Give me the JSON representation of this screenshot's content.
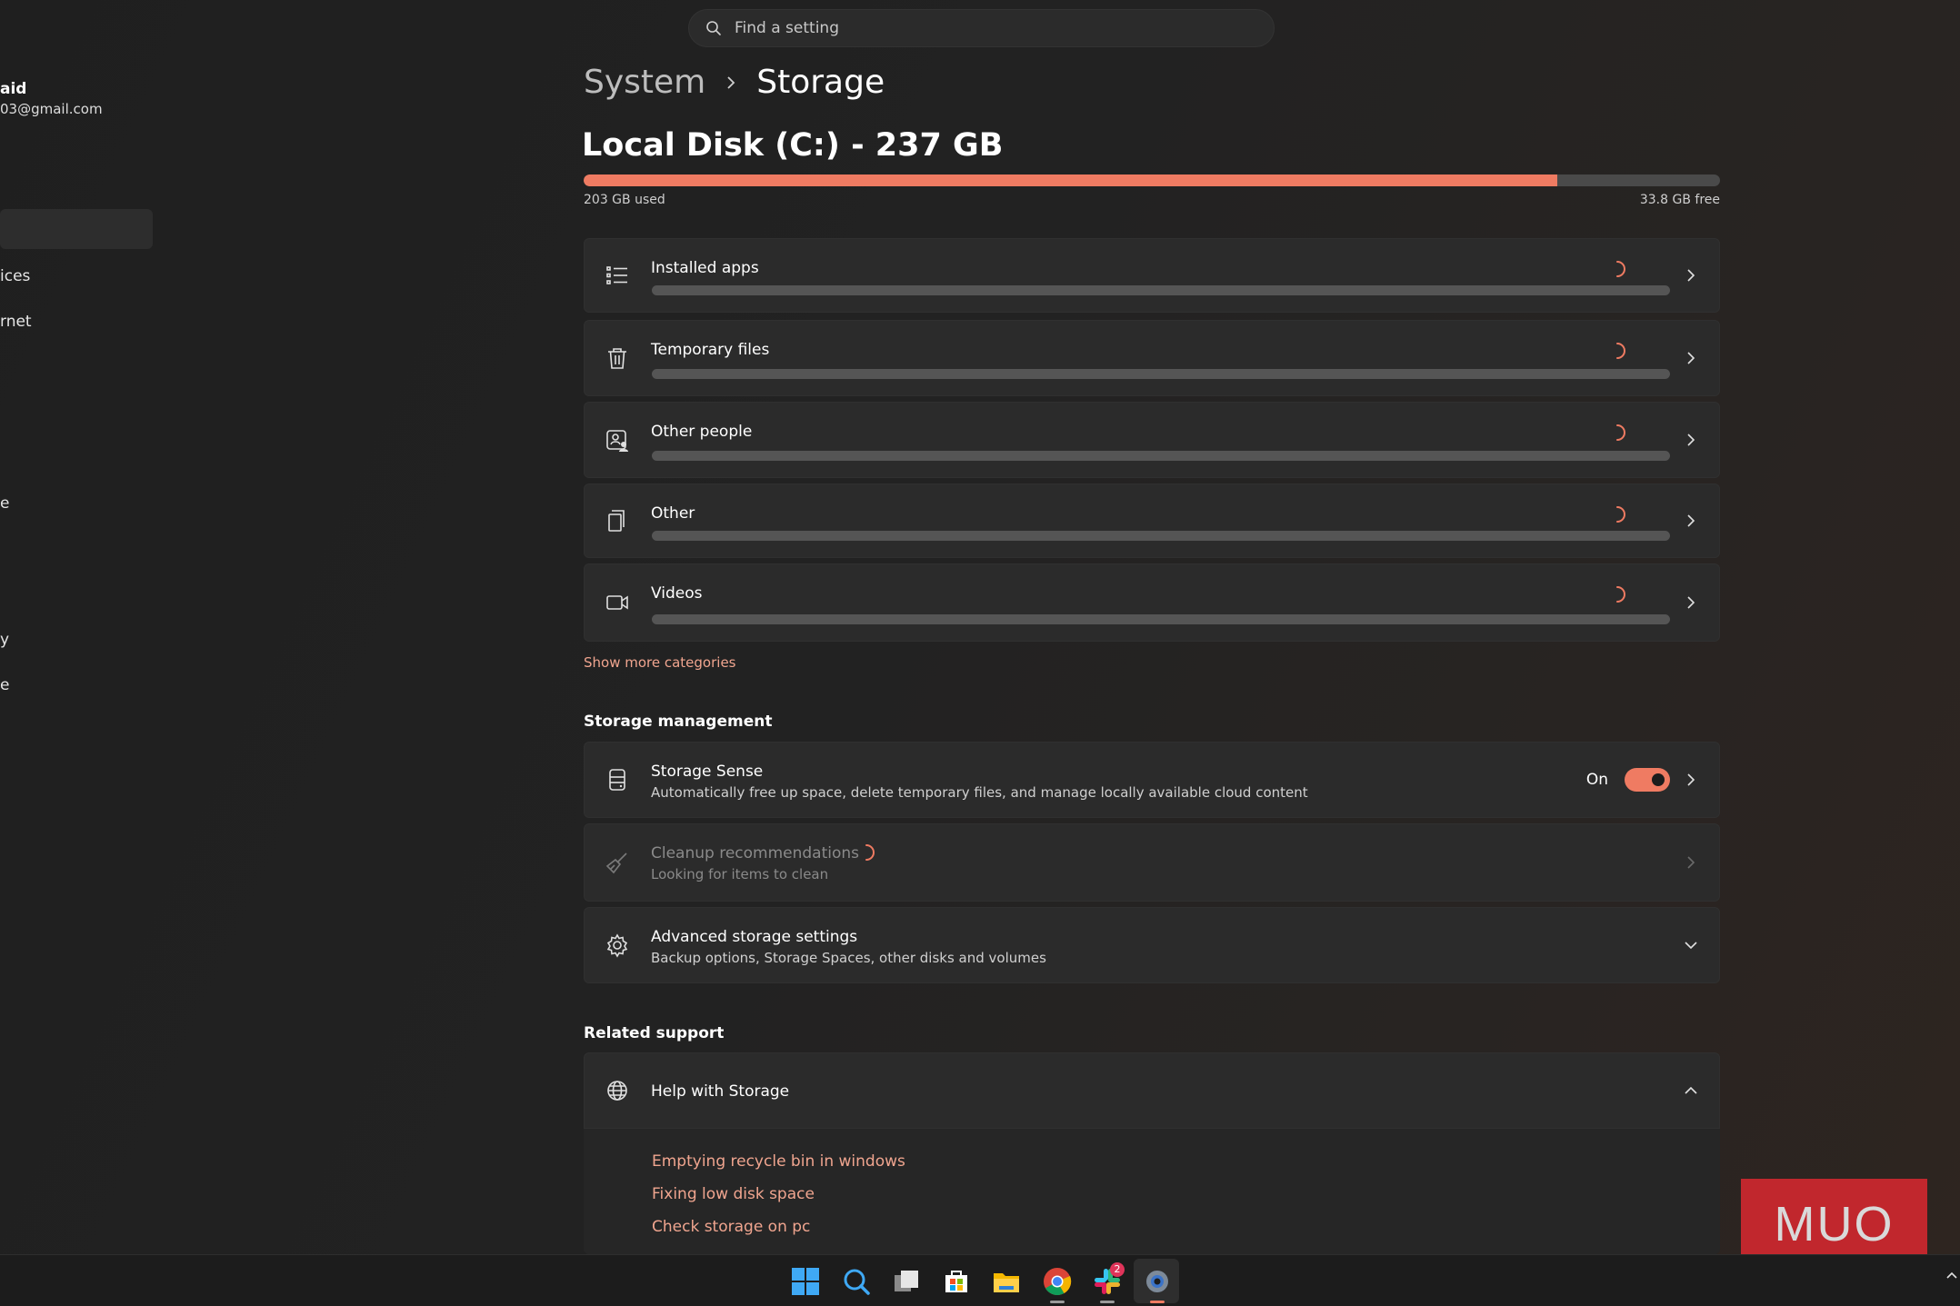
{
  "sidebar": {
    "user_name": "aid",
    "user_email": "03@gmail.com",
    "items": [
      {
        "label": "ices"
      },
      {
        "label": "rnet"
      },
      {
        "label": "e"
      },
      {
        "label": "y"
      },
      {
        "label": "e"
      }
    ]
  },
  "search": {
    "placeholder": "Find a setting",
    "icon": "search-icon"
  },
  "breadcrumb": {
    "parent": "System",
    "current": "Storage"
  },
  "disk": {
    "title": "Local Disk (C:) - 237 GB",
    "used_label": "203 GB used",
    "free_label": "33.8 GB free",
    "used_gb": 203,
    "free_gb": 33.8,
    "usage_fraction": 0.857,
    "bar_color": "#ef7b62"
  },
  "categories": [
    {
      "label": "Installed apps",
      "icon": "list-icon"
    },
    {
      "label": "Temporary files",
      "icon": "trash-icon"
    },
    {
      "label": "Other people",
      "icon": "people-icon"
    },
    {
      "label": "Other",
      "icon": "document-icon"
    },
    {
      "label": "Videos",
      "icon": "video-icon"
    }
  ],
  "show_more": "Show more categories",
  "storage_management": {
    "heading": "Storage management",
    "storage_sense": {
      "title": "Storage Sense",
      "subtitle": "Automatically free up space, delete temporary files, and manage locally available cloud content",
      "state": "On",
      "enabled": true
    },
    "cleanup": {
      "title": "Cleanup recommendations",
      "subtitle": "Looking for items to clean"
    },
    "advanced": {
      "title": "Advanced storage settings",
      "subtitle": "Backup options, Storage Spaces, other disks and volumes"
    }
  },
  "related_support": {
    "heading": "Related support",
    "help_title": "Help with Storage",
    "links": [
      "Emptying recycle bin in windows",
      "Fixing low disk space",
      "Check storage on pc"
    ]
  },
  "watermark": "MUO",
  "taskbar": {
    "icons": [
      "start-icon",
      "search-icon",
      "task-view-icon",
      "store-icon",
      "file-explorer-icon",
      "chrome-icon",
      "slack-icon",
      "settings-icon"
    ],
    "slack_badge": "2"
  },
  "colors": {
    "accent": "#ef7b62",
    "link": "#f0a58f",
    "card": "#2b2b2b"
  }
}
